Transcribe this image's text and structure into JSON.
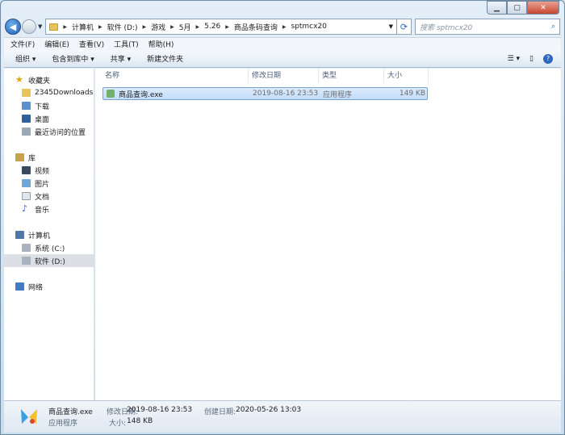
{
  "search": {
    "placeholder": "搜索 sptmcx20"
  },
  "breadcrumb": [
    "计算机",
    "软件 (D:)",
    "游戏",
    "5月",
    "5.26",
    "商品条码查询",
    "sptmcx20"
  ],
  "menu": [
    "文件(F)",
    "编辑(E)",
    "查看(V)",
    "工具(T)",
    "帮助(H)"
  ],
  "toolbar": {
    "organize": "组织 ▾",
    "include": "包含到库中 ▾",
    "share": "共享 ▾",
    "new_folder": "新建文件夹"
  },
  "sidebar": {
    "favorites": "收藏夹",
    "fav_items": [
      "2345Downloads",
      "下载",
      "桌面",
      "最近访问的位置"
    ],
    "libraries": "库",
    "lib_items": [
      "视频",
      "图片",
      "文档",
      "音乐"
    ],
    "computer": "计算机",
    "comp_items": [
      "系统 (C:)",
      "软件 (D:)"
    ],
    "network": "网络"
  },
  "columns": [
    "名称",
    "修改日期",
    "类型",
    "大小"
  ],
  "files": [
    {
      "name": "商品查询.exe",
      "modified": "2019-08-16 23:53",
      "type": "应用程序",
      "size": "149 KB"
    }
  ],
  "details": {
    "name": "商品查询.exe",
    "type": "应用程序",
    "modified_label": "修改日期:",
    "modified": "2019-08-16 23:53",
    "created_label": "创建日期:",
    "created": "2020-05-26 13:03",
    "size_label": "大小:",
    "size": "148 KB"
  }
}
